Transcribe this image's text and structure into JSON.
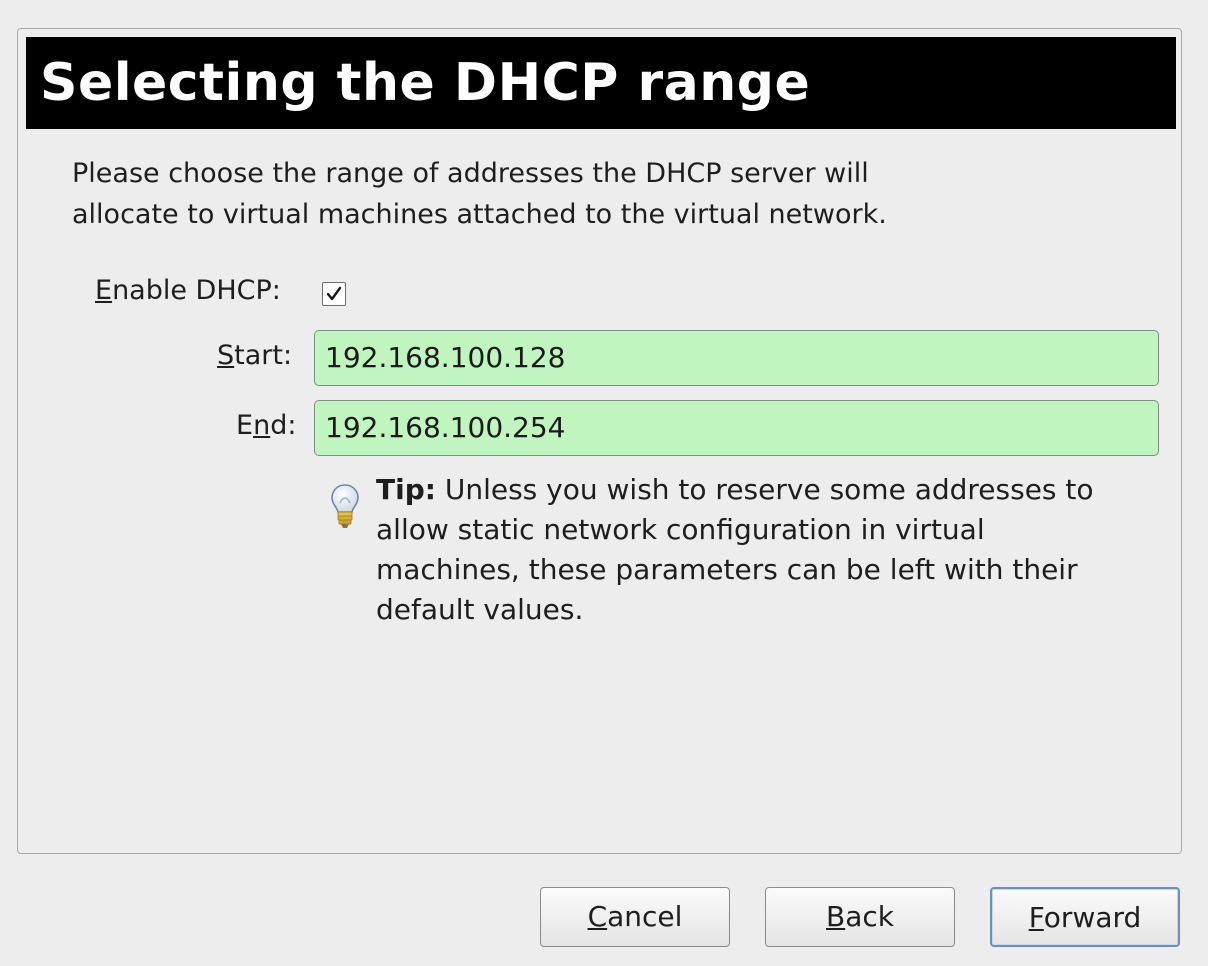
{
  "page": {
    "title": "Selecting the DHCP range",
    "intro_line1": "Please choose the range of addresses the DHCP server will",
    "intro_line2": "allocate to virtual machines attached to the virtual network."
  },
  "form": {
    "enable_dhcp": {
      "mnemonic": "E",
      "label_rest": "nable DHCP:",
      "checked": true
    },
    "start": {
      "mnemonic": "S",
      "label_rest": "tart:",
      "value": "192.168.100.128"
    },
    "end": {
      "label_pre": "E",
      "mnemonic": "n",
      "label_rest": "d:",
      "value": "192.168.100.254"
    }
  },
  "tip": {
    "prefix": "Tip:",
    "line1": " Unless you wish to reserve some addresses to",
    "line2": "allow static network configuration in virtual",
    "line3": "machines, these parameters can be left with their",
    "line4": "default values.",
    "icon": "lightbulb-icon"
  },
  "buttons": {
    "cancel": {
      "mnemonic": "C",
      "rest": "ancel"
    },
    "back": {
      "mnemonic": "B",
      "rest": "ack"
    },
    "forward": {
      "mnemonic": "F",
      "rest": "orward"
    }
  },
  "colors": {
    "banner_bg": "#000000",
    "field_bg": "#c0f5c0",
    "default_button_border": "#6c8fbf"
  }
}
